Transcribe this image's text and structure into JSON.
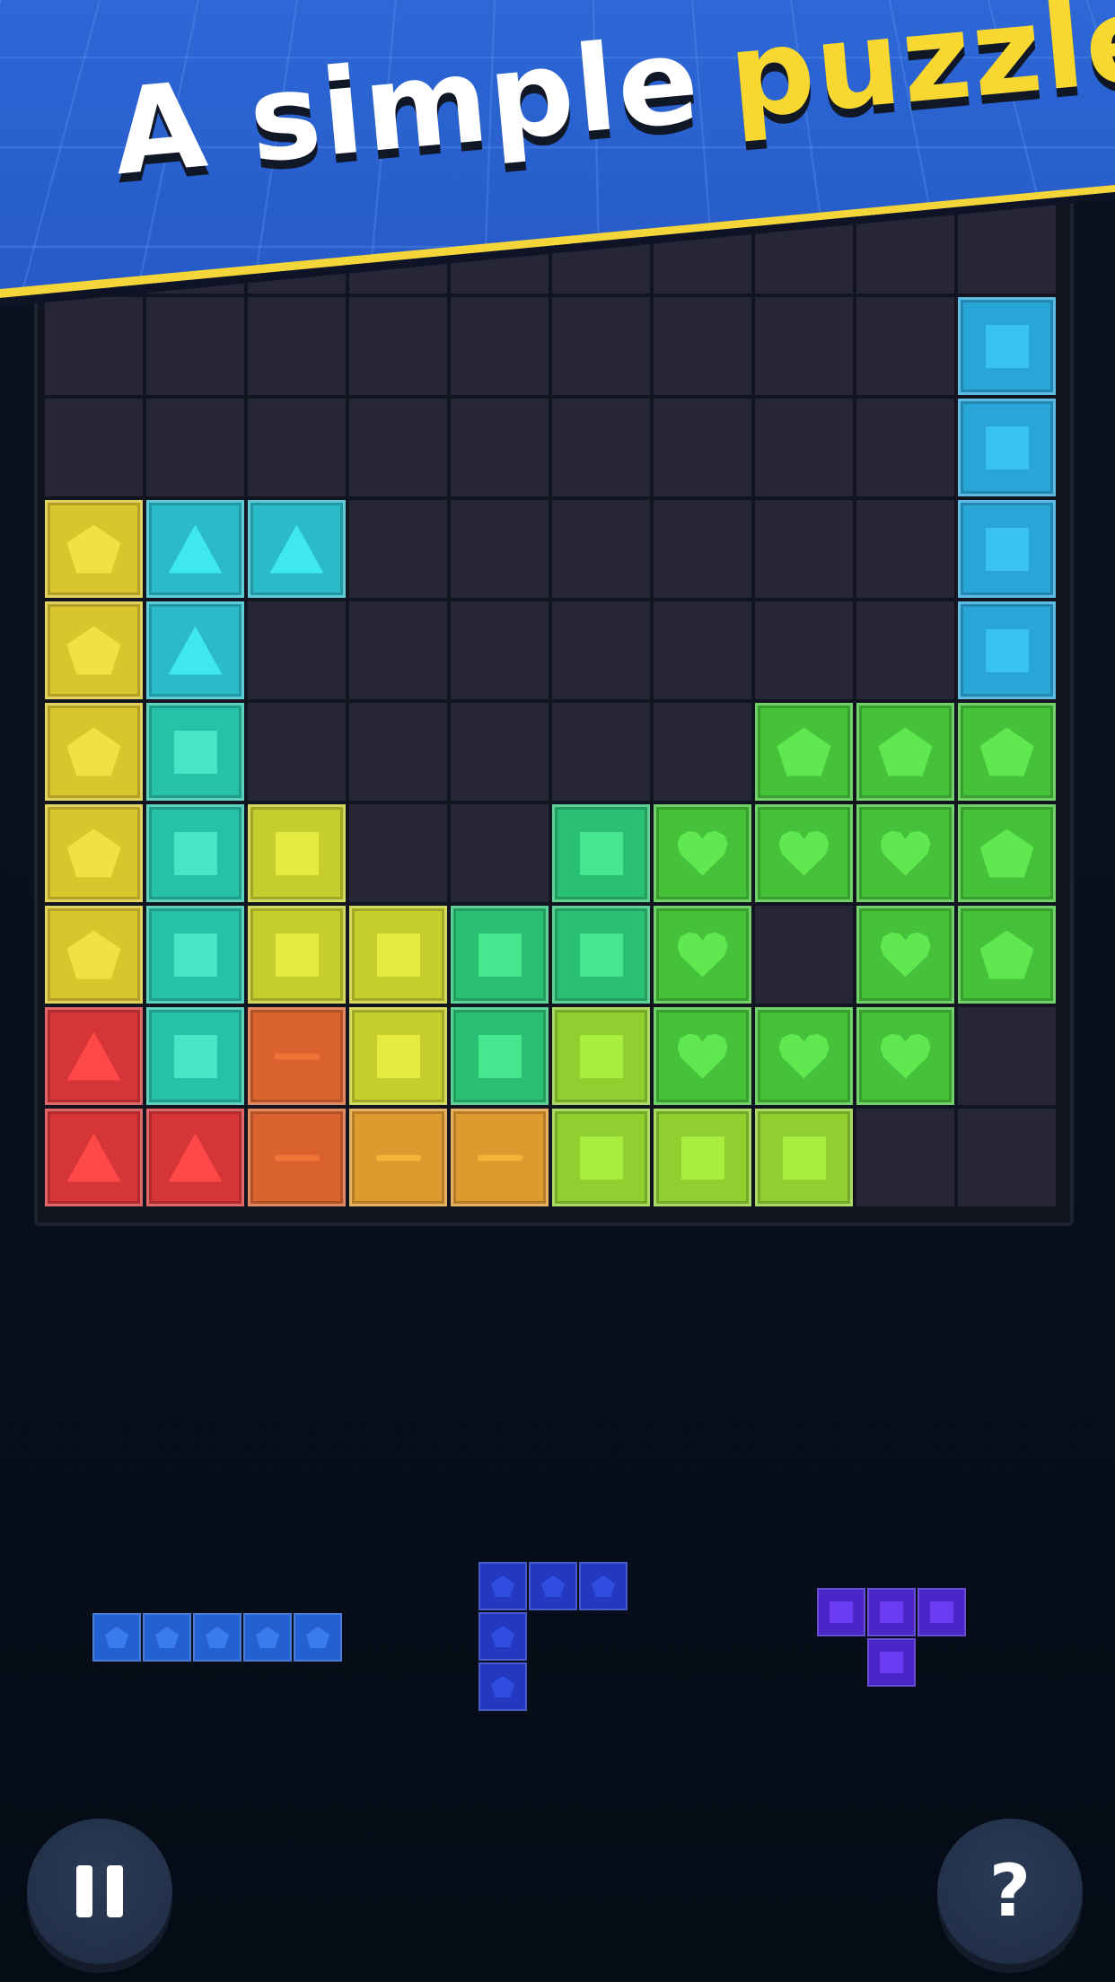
{
  "banner": {
    "title_white": "A simple",
    "title_yellow": "puzzle"
  },
  "palette": {
    "empty": "#262636",
    "yellow": {
      "bg": "#d9c52c",
      "sym": "#f3e042"
    },
    "cyan": {
      "bg": "#2abac8",
      "sym": "#3fe7ef"
    },
    "teal": {
      "bg": "#27c0a8",
      "sym": "#46e6c6"
    },
    "blue": {
      "bg": "#2aa5d8",
      "sym": "#39c3f1"
    },
    "green": {
      "bg": "#45c23a",
      "sym": "#5fe84f"
    },
    "emerald": {
      "bg": "#2ac073",
      "sym": "#46e68f"
    },
    "lime": {
      "bg": "#8fcf30",
      "sym": "#a9ee3e"
    },
    "olive": {
      "bg": "#c6cd2e",
      "sym": "#e4ec40"
    },
    "red": {
      "bg": "#d63537",
      "sym": "#ff4848"
    },
    "orange": {
      "bg": "#d9622f",
      "sym": "#f07338"
    },
    "amber": {
      "bg": "#dd9a2f",
      "sym": "#f3b43a"
    }
  },
  "board": {
    "rows": [
      [
        null,
        null,
        null,
        null,
        null,
        null,
        null,
        null,
        null,
        null
      ],
      [
        null,
        null,
        null,
        null,
        null,
        null,
        null,
        null,
        null,
        {
          "c": "blue",
          "s": "square"
        }
      ],
      [
        null,
        null,
        null,
        null,
        null,
        null,
        null,
        null,
        null,
        {
          "c": "blue",
          "s": "square"
        }
      ],
      [
        {
          "c": "yellow",
          "s": "pentagon"
        },
        {
          "c": "cyan",
          "s": "triangle"
        },
        {
          "c": "cyan",
          "s": "triangle"
        },
        null,
        null,
        null,
        null,
        null,
        null,
        {
          "c": "blue",
          "s": "square"
        }
      ],
      [
        {
          "c": "yellow",
          "s": "pentagon"
        },
        {
          "c": "cyan",
          "s": "triangle"
        },
        null,
        null,
        null,
        null,
        null,
        null,
        null,
        {
          "c": "blue",
          "s": "square"
        }
      ],
      [
        {
          "c": "yellow",
          "s": "pentagon"
        },
        {
          "c": "teal",
          "s": "square"
        },
        null,
        null,
        null,
        null,
        null,
        {
          "c": "green",
          "s": "pentagon"
        },
        {
          "c": "green",
          "s": "pentagon"
        },
        {
          "c": "green",
          "s": "pentagon"
        }
      ],
      [
        {
          "c": "yellow",
          "s": "pentagon"
        },
        {
          "c": "teal",
          "s": "square"
        },
        {
          "c": "olive",
          "s": "square"
        },
        null,
        null,
        {
          "c": "emerald",
          "s": "square"
        },
        {
          "c": "green",
          "s": "heart"
        },
        {
          "c": "green",
          "s": "heart"
        },
        {
          "c": "green",
          "s": "heart"
        },
        {
          "c": "green",
          "s": "pentagon"
        }
      ],
      [
        {
          "c": "yellow",
          "s": "pentagon"
        },
        {
          "c": "teal",
          "s": "square"
        },
        {
          "c": "olive",
          "s": "square"
        },
        {
          "c": "olive",
          "s": "square"
        },
        {
          "c": "emerald",
          "s": "square"
        },
        {
          "c": "emerald",
          "s": "square"
        },
        {
          "c": "green",
          "s": "heart"
        },
        null,
        {
          "c": "green",
          "s": "heart"
        },
        {
          "c": "green",
          "s": "pentagon"
        }
      ],
      [
        {
          "c": "red",
          "s": "triangle"
        },
        {
          "c": "teal",
          "s": "square"
        },
        {
          "c": "orange",
          "s": "dash"
        },
        {
          "c": "olive",
          "s": "square"
        },
        {
          "c": "emerald",
          "s": "square"
        },
        {
          "c": "lime",
          "s": "square"
        },
        {
          "c": "green",
          "s": "heart"
        },
        {
          "c": "green",
          "s": "heart"
        },
        {
          "c": "green",
          "s": "heart"
        },
        null
      ],
      [
        {
          "c": "red",
          "s": "triangle"
        },
        {
          "c": "red",
          "s": "triangle"
        },
        {
          "c": "orange",
          "s": "dash"
        },
        {
          "c": "amber",
          "s": "dash"
        },
        {
          "c": "amber",
          "s": "dash"
        },
        {
          "c": "lime",
          "s": "square"
        },
        {
          "c": "lime",
          "s": "square"
        },
        {
          "c": "lime",
          "s": "square"
        },
        null,
        null
      ]
    ]
  },
  "pieces": [
    {
      "name": "piece-i5-blue",
      "color": "#2461d0",
      "sym": "#3a7cf0",
      "shape": "pentagon",
      "cells": [
        [
          0,
          0
        ],
        [
          1,
          0
        ],
        [
          2,
          0
        ],
        [
          3,
          0
        ],
        [
          4,
          0
        ]
      ]
    },
    {
      "name": "piece-l-navy",
      "color": "#2238c0",
      "sym": "#2f4de0",
      "shape": "pentagon",
      "cells": [
        [
          0,
          0
        ],
        [
          1,
          0
        ],
        [
          2,
          0
        ],
        [
          0,
          1
        ],
        [
          0,
          2
        ]
      ]
    },
    {
      "name": "piece-t-purple",
      "color": "#4a26c8",
      "sym": "#6a3bf0",
      "shape": "square",
      "cells": [
        [
          0,
          0
        ],
        [
          1,
          0
        ],
        [
          2,
          0
        ],
        [
          1,
          1
        ]
      ]
    }
  ],
  "controls": {
    "help_label": "?"
  }
}
